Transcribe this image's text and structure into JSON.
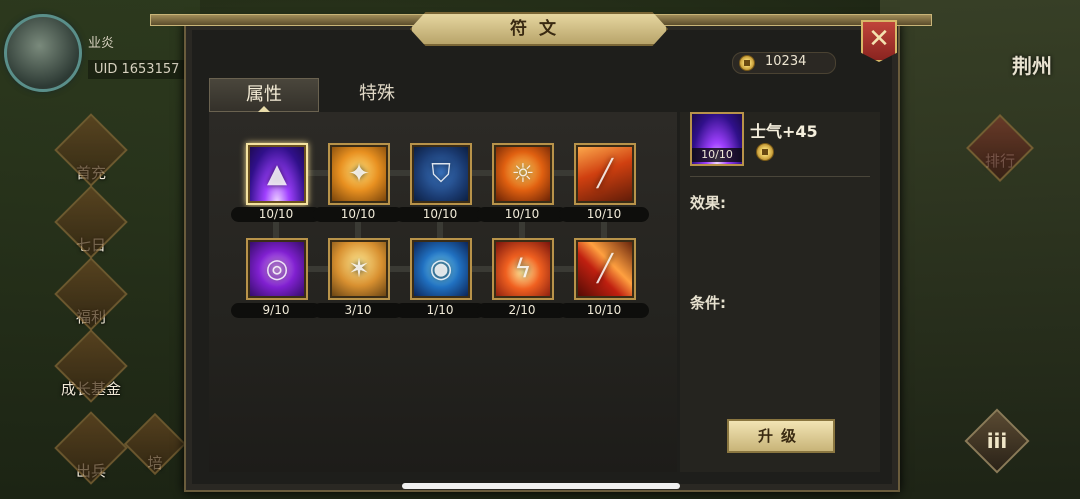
{
  "player": {
    "name": "业炎",
    "uid": "UID 1653157"
  },
  "left_menu": [
    {
      "label": "首充",
      "icon": "first-recharge-icon"
    },
    {
      "label": "七日",
      "icon": "seven-day-icon"
    },
    {
      "label": "福利",
      "icon": "welfare-icon"
    },
    {
      "label": "成长基金",
      "icon": "growth-fund-icon"
    },
    {
      "label": "出兵",
      "icon": "dispatch-troops-icon"
    },
    {
      "label": "培",
      "icon": "train-icon"
    }
  ],
  "right_menu": {
    "city": "荆州",
    "rank_label": "排行",
    "menu_icon_text": "iii"
  },
  "dialog": {
    "title": "符文",
    "close_icon": "close-icon",
    "coins": "10234",
    "tabs": [
      {
        "label": "属性",
        "active": true
      },
      {
        "label": "特殊",
        "active": false
      }
    ]
  },
  "runes": [
    {
      "count": "10/10",
      "icon": "purple-light-icon",
      "selected": true
    },
    {
      "count": "10/10",
      "icon": "kick-icon",
      "selected": false
    },
    {
      "count": "10/10",
      "icon": "shield-icon",
      "selected": false
    },
    {
      "count": "10/10",
      "icon": "fire-warrior-icon",
      "selected": false
    },
    {
      "count": "10/10",
      "icon": "blade-icon",
      "selected": false
    },
    {
      "count": "9/10",
      "icon": "purple-spiral-icon",
      "selected": false
    },
    {
      "count": "3/10",
      "icon": "fight-icon",
      "selected": false
    },
    {
      "count": "1/10",
      "icon": "blue-aura-icon",
      "selected": false
    },
    {
      "count": "2/10",
      "icon": "lightning-icon",
      "selected": false
    },
    {
      "count": "10/10",
      "icon": "flame-sword-icon",
      "selected": false
    }
  ],
  "detail": {
    "name": "士气+45",
    "count": "10/10",
    "effect_label": "效果:",
    "condition_label": "条件:",
    "upgrade_label": "升级"
  }
}
